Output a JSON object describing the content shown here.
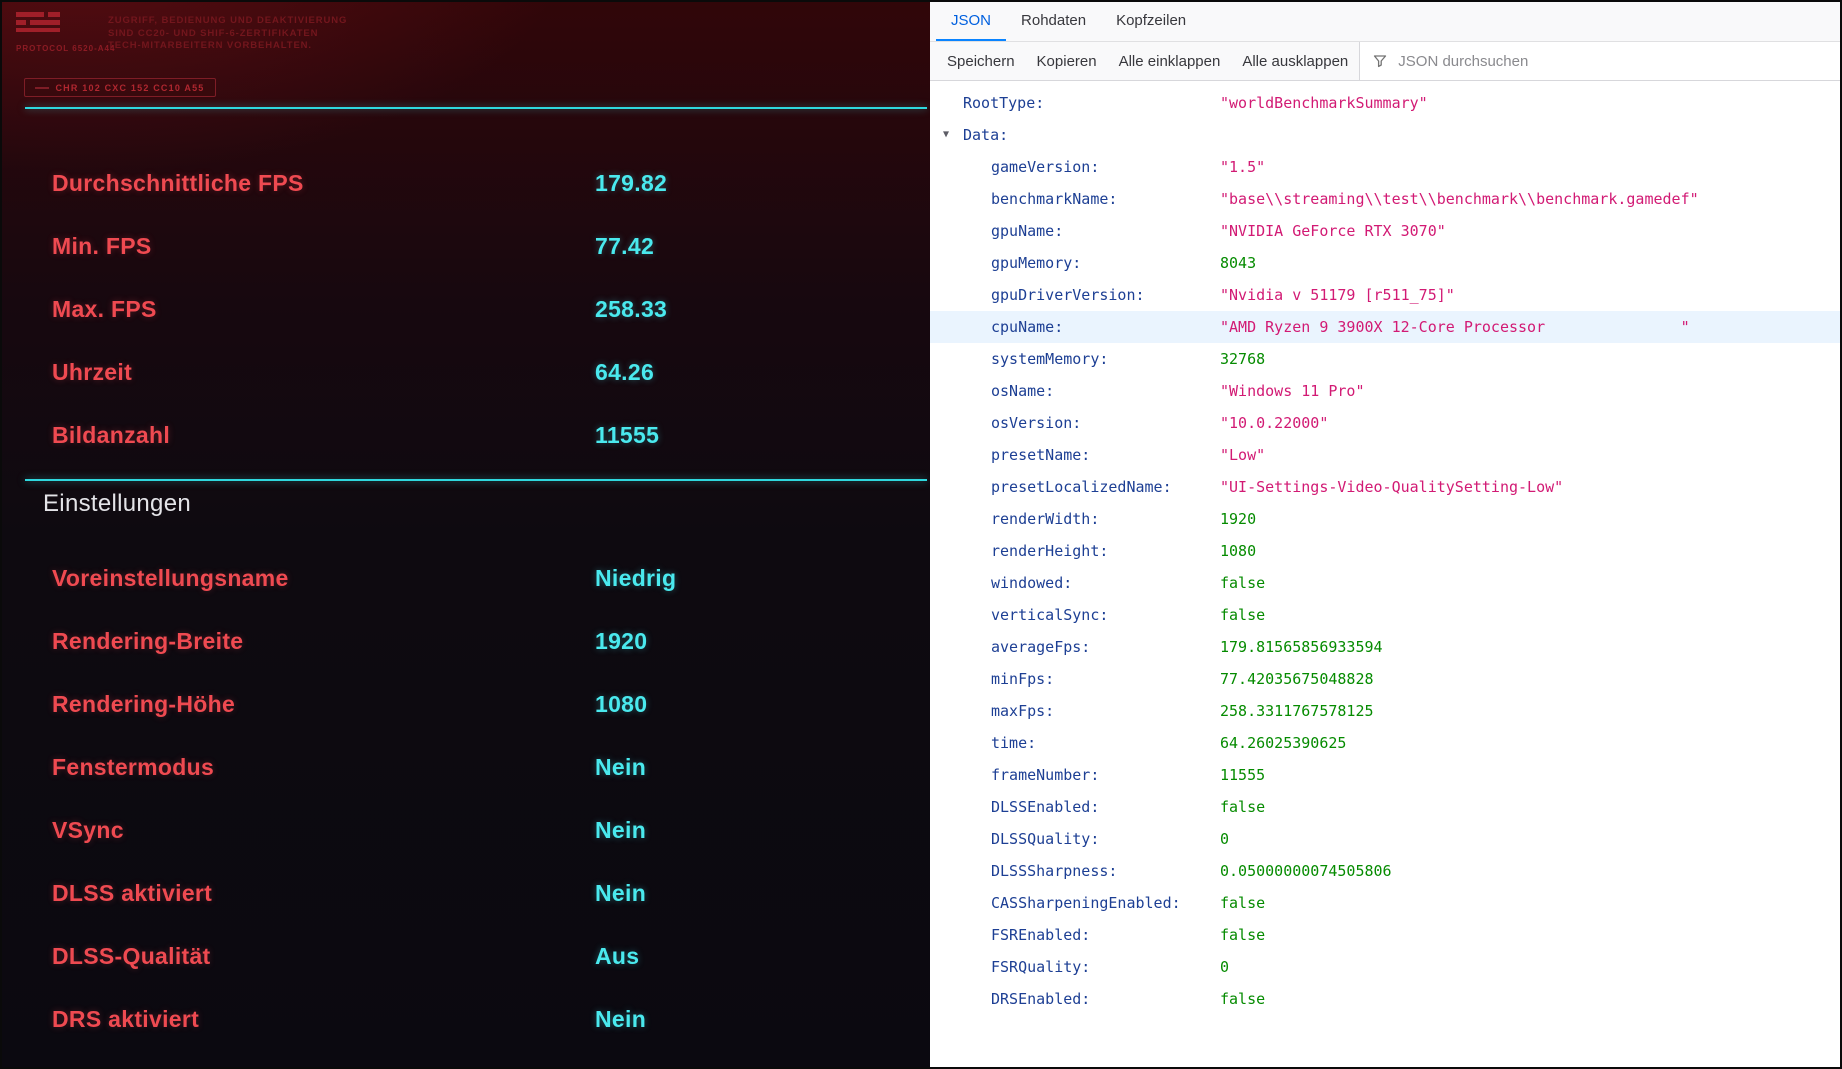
{
  "game_panel": {
    "header": {
      "logo_text": "PROTOCOL 6520-A44",
      "disclaimer_lines": [
        "ZUGRIFF, BEDIENUNG UND DEAKTIVIERUNG",
        "SIND CC20- UND SHIF-6-ZERTIFIKATEN",
        "TECH-MITARBEITERN VORBEHALTEN."
      ],
      "badge": "CHR 102 CXC 152 CC10 A55"
    },
    "results": [
      {
        "label": "Durchschnittliche FPS",
        "value": "179.82"
      },
      {
        "label": "Min. FPS",
        "value": "77.42"
      },
      {
        "label": "Max. FPS",
        "value": "258.33"
      },
      {
        "label": "Uhrzeit",
        "value": "64.26"
      },
      {
        "label": "Bildanzahl",
        "value": "11555"
      }
    ],
    "settings_heading": "Einstellungen",
    "settings": [
      {
        "label": "Voreinstellungsname",
        "value": "Niedrig"
      },
      {
        "label": "Rendering-Breite",
        "value": "1920"
      },
      {
        "label": "Rendering-Höhe",
        "value": "1080"
      },
      {
        "label": "Fenstermodus",
        "value": "Nein"
      },
      {
        "label": "VSync",
        "value": "Nein"
      },
      {
        "label": "DLSS aktiviert",
        "value": "Nein"
      },
      {
        "label": "DLSS-Qualität",
        "value": "Aus"
      },
      {
        "label": "DRS aktiviert",
        "value": "Nein"
      }
    ],
    "colors": {
      "label": "#ef4a51",
      "value": "#4ae9ee",
      "divider": "#2fd8df",
      "heading": "#e4e4e8"
    }
  },
  "devtools": {
    "tabs": [
      {
        "label": "JSON",
        "active": true
      },
      {
        "label": "Rohdaten",
        "active": false
      },
      {
        "label": "Kopfzeilen",
        "active": false
      }
    ],
    "toolbar": {
      "buttons": [
        "Speichern",
        "Kopieren",
        "Alle einklappen",
        "Alle ausklappen"
      ],
      "search_placeholder": "JSON durchsuchen"
    },
    "json_tree": {
      "rows": [
        {
          "key": "RootType",
          "value": "worldBenchmarkSummary",
          "type": "string",
          "level": 0
        },
        {
          "key": "Data",
          "type": "object",
          "level": 0,
          "expanded": true
        },
        {
          "key": "gameVersion",
          "value": "1.5",
          "type": "string",
          "level": 1
        },
        {
          "key": "benchmarkName",
          "value": "base\\\\streaming\\\\test\\\\benchmark\\\\benchmark.gamedef",
          "type": "string",
          "level": 1
        },
        {
          "key": "gpuName",
          "value": "NVIDIA GeForce RTX 3070",
          "type": "string",
          "level": 1
        },
        {
          "key": "gpuMemory",
          "value": "8043",
          "type": "number",
          "level": 1
        },
        {
          "key": "gpuDriverVersion",
          "value": "Nvidia v 51179 [r511_75]",
          "type": "string",
          "level": 1
        },
        {
          "key": "cpuName",
          "value": "AMD Ryzen 9 3900X 12-Core Processor               ",
          "type": "string",
          "level": 1,
          "highlighted": true
        },
        {
          "key": "systemMemory",
          "value": "32768",
          "type": "number",
          "level": 1
        },
        {
          "key": "osName",
          "value": "Windows 11 Pro",
          "type": "string",
          "level": 1
        },
        {
          "key": "osVersion",
          "value": "10.0.22000",
          "type": "string",
          "level": 1
        },
        {
          "key": "presetName",
          "value": "Low",
          "type": "string",
          "level": 1
        },
        {
          "key": "presetLocalizedName",
          "value": "UI-Settings-Video-QualitySetting-Low",
          "type": "string",
          "level": 1
        },
        {
          "key": "renderWidth",
          "value": "1920",
          "type": "number",
          "level": 1
        },
        {
          "key": "renderHeight",
          "value": "1080",
          "type": "number",
          "level": 1
        },
        {
          "key": "windowed",
          "value": "false",
          "type": "boolean",
          "level": 1
        },
        {
          "key": "verticalSync",
          "value": "false",
          "type": "boolean",
          "level": 1
        },
        {
          "key": "averageFps",
          "value": "179.81565856933594",
          "type": "number",
          "level": 1
        },
        {
          "key": "minFps",
          "value": "77.42035675048828",
          "type": "number",
          "level": 1
        },
        {
          "key": "maxFps",
          "value": "258.3311767578125",
          "type": "number",
          "level": 1
        },
        {
          "key": "time",
          "value": "64.26025390625",
          "type": "number",
          "level": 1
        },
        {
          "key": "frameNumber",
          "value": "11555",
          "type": "number",
          "level": 1
        },
        {
          "key": "DLSSEnabled",
          "value": "false",
          "type": "boolean",
          "level": 1
        },
        {
          "key": "DLSSQuality",
          "value": "0",
          "type": "number",
          "level": 1
        },
        {
          "key": "DLSSSharpness",
          "value": "0.05000000074505806",
          "type": "number",
          "level": 1
        },
        {
          "key": "CASSharpeningEnabled",
          "value": "false",
          "type": "boolean",
          "level": 1
        },
        {
          "key": "FSREnabled",
          "value": "false",
          "type": "boolean",
          "level": 1
        },
        {
          "key": "FSRQuality",
          "value": "0",
          "type": "number",
          "level": 1
        },
        {
          "key": "DRSEnabled",
          "value": "false",
          "type": "boolean",
          "level": 1
        }
      ],
      "colors": {
        "key": "#1d3f94",
        "string": "#d21a74",
        "number": "#058b00",
        "boolean": "#058b00",
        "highlight_bg": "#eaf4fe",
        "active_tab": "#0060df"
      }
    }
  }
}
